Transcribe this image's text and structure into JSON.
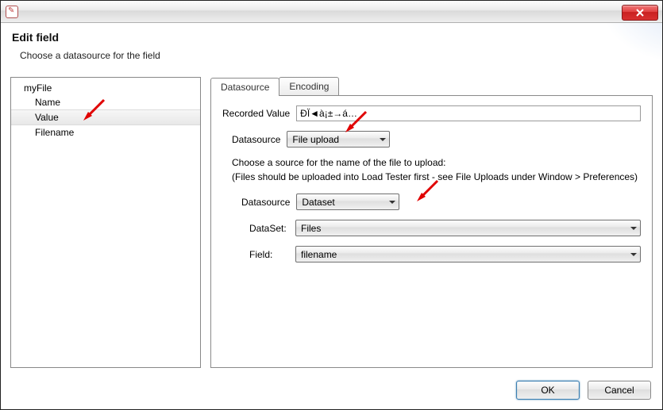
{
  "header": {
    "title": "Edit field",
    "subtitle": "Choose a datasource for the field"
  },
  "tree": {
    "root": "myFile",
    "items": [
      "Name",
      "Value",
      "Filename"
    ],
    "selected_index": 1
  },
  "tabs": {
    "items": [
      "Datasource",
      "Encoding"
    ],
    "active_index": 0
  },
  "fields": {
    "recorded_value_label": "Recorded Value",
    "recorded_value": "ÐÏ◄à¡±→á…",
    "datasource_label": "Datasource",
    "datasource_value": "File upload",
    "hint_line1": "Choose a source for the name of the file to upload:",
    "hint_line2": "(Files should be uploaded into Load Tester first - see File Uploads under Window > Preferences)",
    "inner_datasource_label": "Datasource",
    "inner_datasource_value": "Dataset",
    "dataset_label": "DataSet:",
    "dataset_value": "Files",
    "field_label": "Field:",
    "field_value": "filename"
  },
  "buttons": {
    "ok": "OK",
    "cancel": "Cancel"
  }
}
